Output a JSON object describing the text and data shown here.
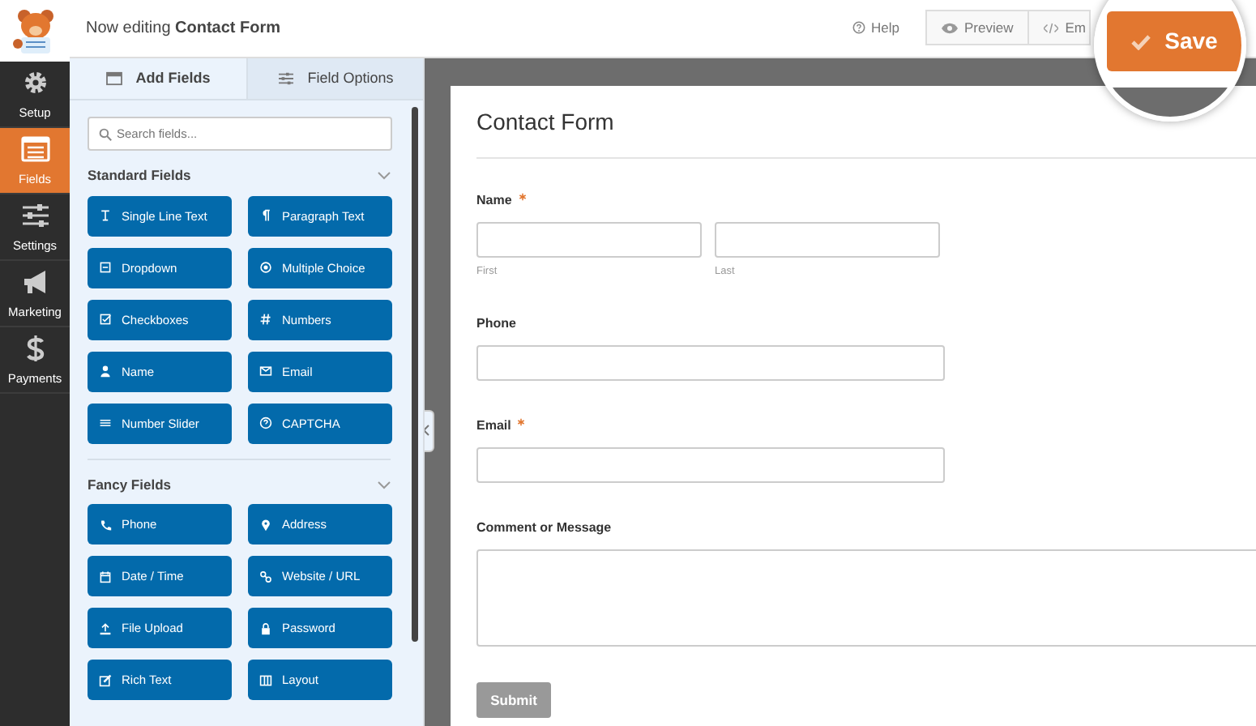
{
  "header": {
    "editing": "Now editing **Contact Form**",
    "help": "Help",
    "preview": "Preview",
    "embed": "Em",
    "save": "Save"
  },
  "nav": [
    {
      "label": "Setup",
      "selected": false
    },
    {
      "label": "Fields",
      "selected": true
    },
    {
      "label": "Settings",
      "selected": false
    },
    {
      "label": "Marketing",
      "selected": false
    },
    {
      "label": "Payments",
      "selected": false
    }
  ],
  "tabs": [
    {
      "label": "Add Fields",
      "selected": true
    },
    {
      "label": "Field Options",
      "selected": false
    }
  ],
  "search": {
    "placeholder": "Search fields..."
  },
  "sections": [
    {
      "title": "Standard Fields",
      "fields": [
        "Single Line Text",
        "Paragraph Text",
        "Dropdown",
        "Multiple Choice",
        "Checkboxes",
        "Numbers",
        "Name",
        "Email",
        "Number Slider",
        "CAPTCHA"
      ]
    },
    {
      "title": "Fancy Fields",
      "fields": [
        "Phone",
        "Address",
        "Date / Time",
        "Website / URL",
        "File Upload",
        "Password",
        "Rich Text",
        "Layout"
      ]
    }
  ],
  "form": {
    "title": "Contact Form",
    "fields": [
      {
        "kind": "name",
        "label": "Name",
        "required": true,
        "sublabels": [
          "First",
          "Last"
        ]
      },
      {
        "kind": "text",
        "label": "Phone",
        "required": false
      },
      {
        "kind": "text",
        "label": "Email",
        "required": true
      },
      {
        "kind": "textarea",
        "label": "Comment or Message",
        "required": false
      }
    ],
    "submit": "Submit"
  }
}
